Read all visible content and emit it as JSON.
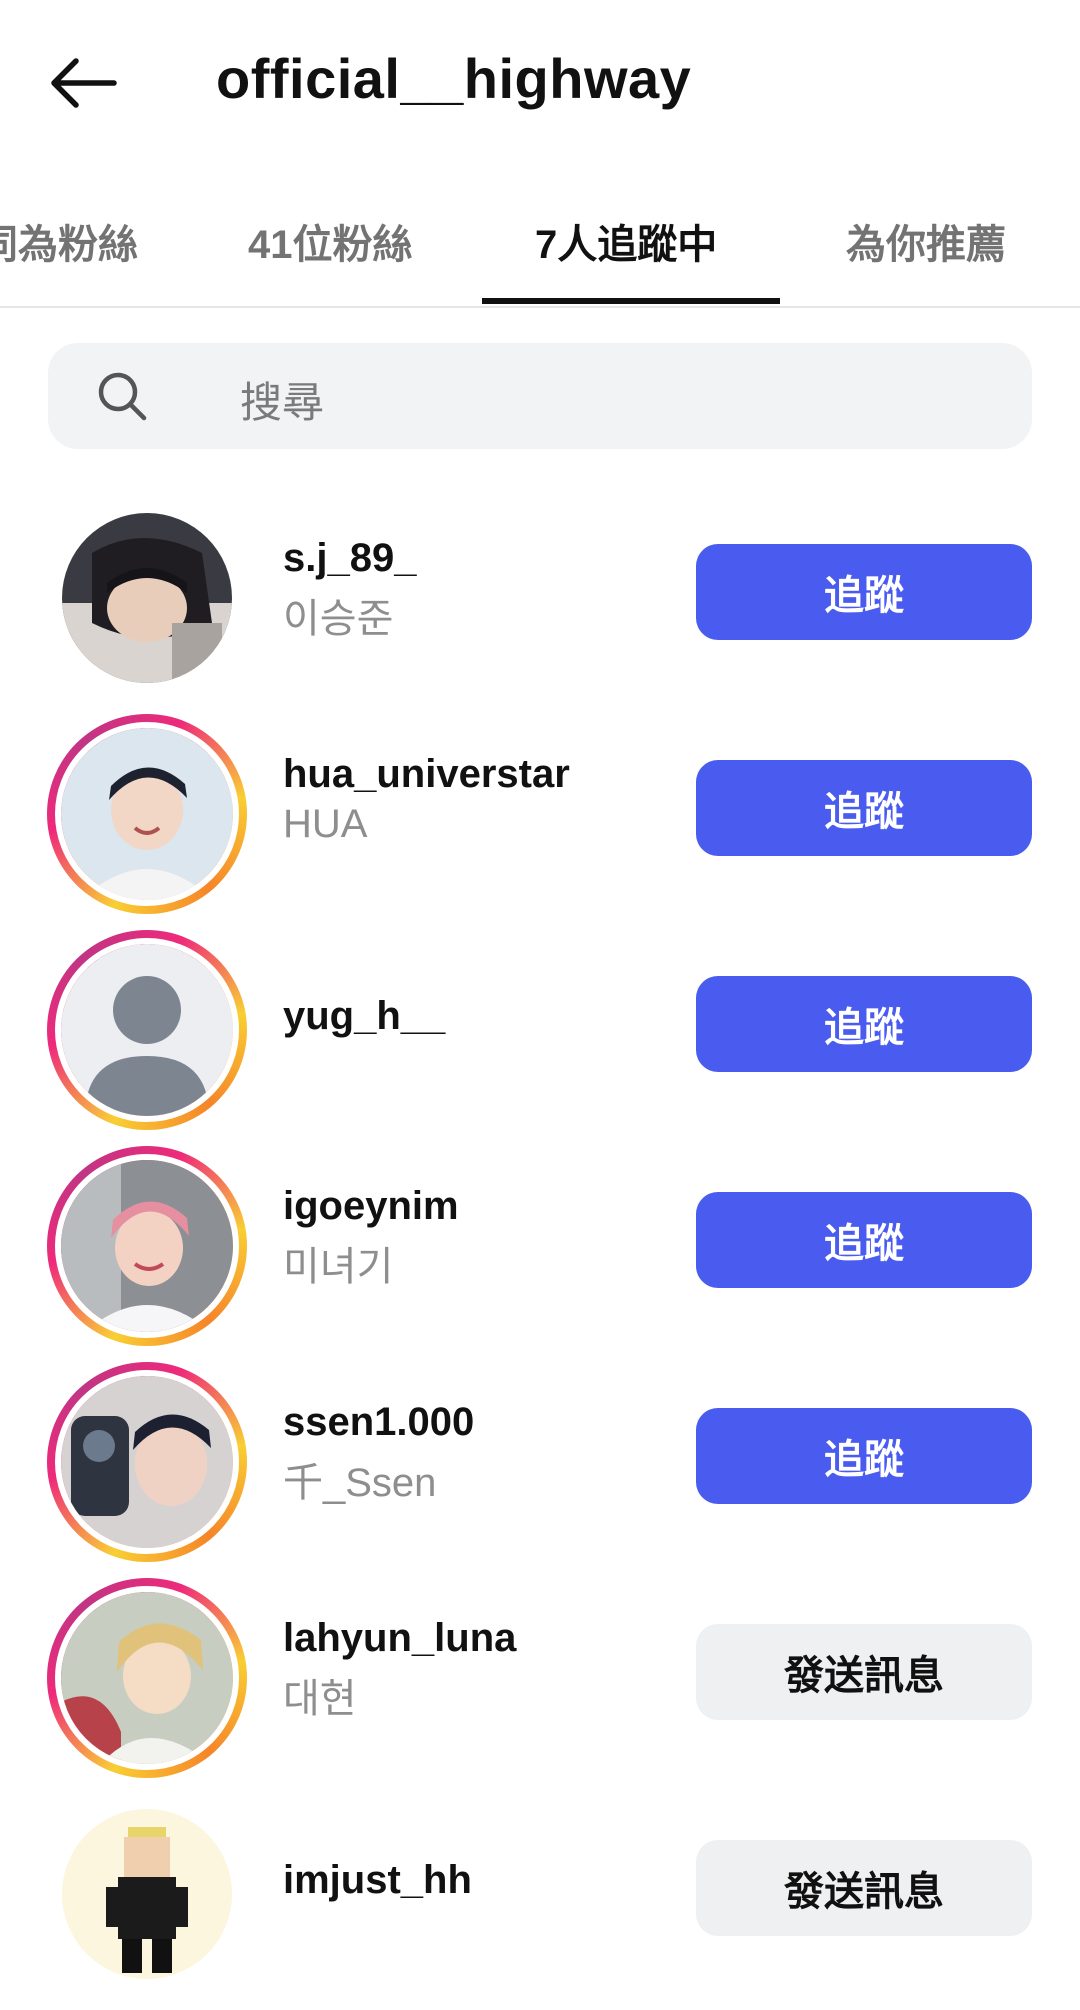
{
  "header": {
    "title": "official__highway",
    "back_icon": "arrow-left-icon"
  },
  "tabs": [
    {
      "label": "同為粉絲",
      "active": false
    },
    {
      "label": "41位粉絲",
      "active": false
    },
    {
      "label": "7人追蹤中",
      "active": true
    },
    {
      "label": "為你推薦",
      "active": false
    }
  ],
  "search": {
    "placeholder": "搜尋",
    "icon": "search-icon"
  },
  "accounts": [
    {
      "username": "s.j_89_",
      "full_name": "이승준",
      "button": "追蹤",
      "story_ring": false
    },
    {
      "username": "hua_universtar",
      "full_name": "HUA",
      "button": "追蹤",
      "story_ring": true
    },
    {
      "username": "yug_h__",
      "full_name": "",
      "button": "追蹤",
      "story_ring": true
    },
    {
      "username": "igoeynim",
      "full_name": "미녀기",
      "button": "追蹤",
      "story_ring": true
    },
    {
      "username": "ssen1.000",
      "full_name": "千_Ssen",
      "button": "追蹤",
      "story_ring": true
    },
    {
      "username": "lahyun_luna",
      "full_name": "대현",
      "button": "發送訊息",
      "story_ring": true
    },
    {
      "username": "imjust_hh",
      "full_name": "",
      "button": "發送訊息",
      "story_ring": false
    }
  ],
  "colors": {
    "follow_button": "#4a5cf0",
    "message_button": "#eff0f2",
    "story_ring_start": "#f9ce34",
    "story_ring_end": "#c13584"
  }
}
